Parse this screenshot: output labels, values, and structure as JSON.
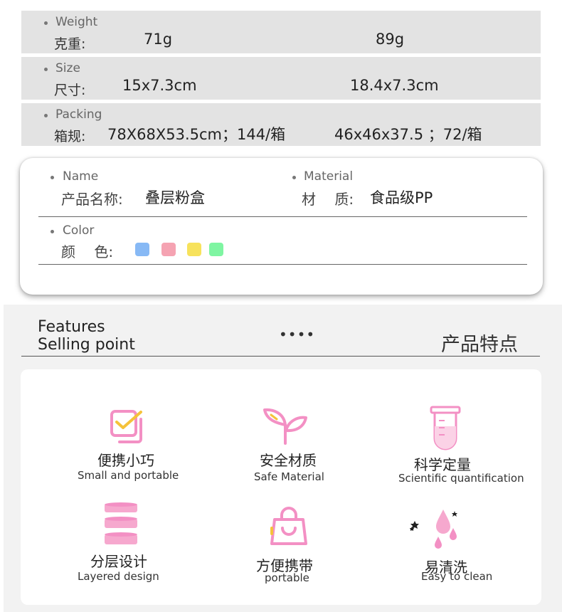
{
  "specs": [
    {
      "en": "Weight",
      "zh": "克重:",
      "v1": "71g",
      "v2": "89g"
    },
    {
      "en": "Size",
      "zh": "尺寸:",
      "v1": "15x7.3cm",
      "v2": "18.4x7.3cm"
    },
    {
      "en": "Packing",
      "zh": "箱规:",
      "v1": "78X68X53.5cm；144/箱",
      "v2": "46x46x37.5 ；72/箱"
    }
  ],
  "info": {
    "name_en": "Name",
    "name_zh": "产品名称:",
    "name_value": "叠层粉盒",
    "material_en": "Material",
    "material_zh": "材　 质:",
    "material_value": "食品级PP",
    "color_en": "Color",
    "color_zh": "颜　 色:",
    "color_swatches": [
      "#87b9f5",
      "#f5a3b2",
      "#f7e25c",
      "#7ff5a2"
    ]
  },
  "features": {
    "title_en_line1": "Features",
    "title_en_line2": "Selling point",
    "dots": "••••",
    "title_zh": "产品特点",
    "items": [
      {
        "zh": "便携小巧",
        "en": "Small and portable",
        "icon": "check-box-icon"
      },
      {
        "zh": "安全材质",
        "en": "Safe Material",
        "icon": "sprout-icon"
      },
      {
        "zh": "科学定量",
        "en": "Scientific quantification",
        "icon": "test-tube-icon"
      },
      {
        "zh": "分层设计",
        "en": "Layered design",
        "icon": "layers-icon"
      },
      {
        "zh": "方便携带",
        "en": "portable",
        "icon": "shopping-bag-icon"
      },
      {
        "zh": "易清洗",
        "en": "Easy to clean",
        "icon": "water-drops-icon"
      }
    ],
    "accent_pink": "#f390c4",
    "accent_yellow": "#f5c23a"
  }
}
